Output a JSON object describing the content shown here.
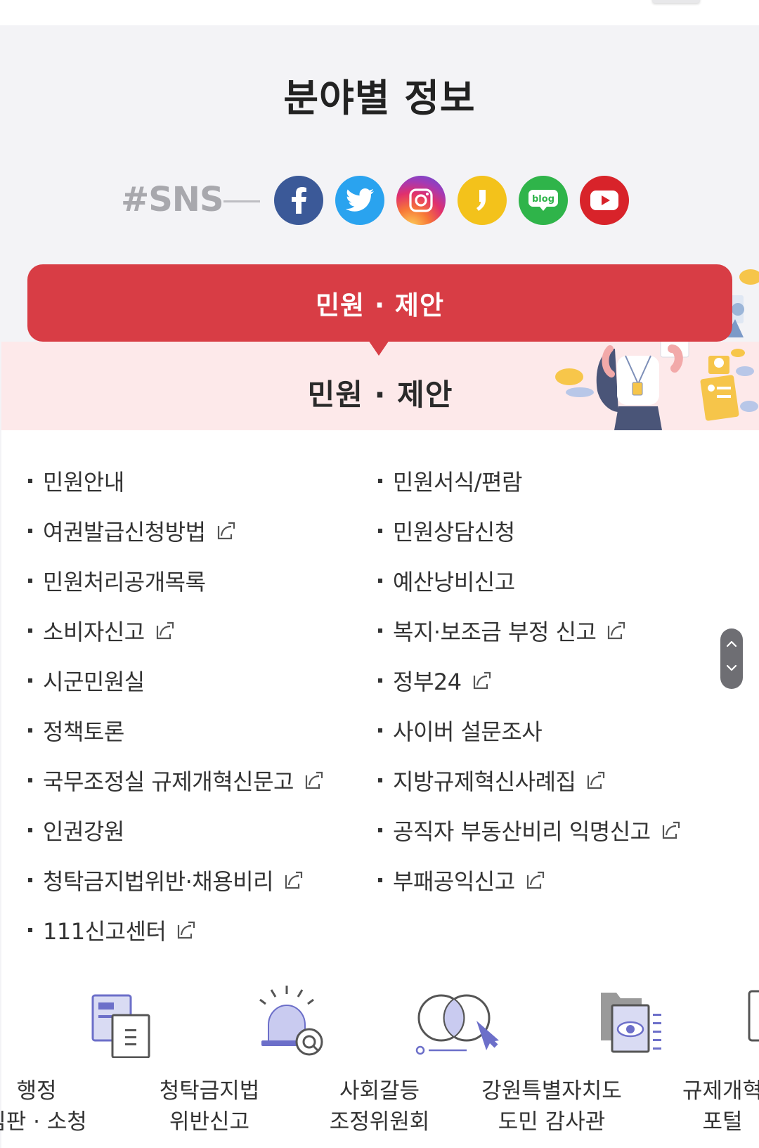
{
  "section_title": "분야별 정보",
  "sns": {
    "label": "#SNS",
    "links": [
      {
        "name": "facebook",
        "color": "#3b5998",
        "icon": "facebook-icon"
      },
      {
        "name": "twitter",
        "color": "#1da1f2",
        "icon": "twitter-icon"
      },
      {
        "name": "instagram",
        "color": "#e1306c",
        "icon": "instagram-icon"
      },
      {
        "name": "kakaostory",
        "color": "#f5c400",
        "icon": "kakaostory-icon"
      },
      {
        "name": "blog",
        "color": "#2db400",
        "icon": "blog-icon",
        "text": "blog"
      },
      {
        "name": "youtube",
        "color": "#e62117",
        "icon": "youtube-icon"
      }
    ]
  },
  "category_tab": "민원 · 제안",
  "banner_title": "민원 · 제안",
  "menu": {
    "left": [
      {
        "label": "민원안내",
        "external": false
      },
      {
        "label": "여권발급신청방법",
        "external": true
      },
      {
        "label": "민원처리공개목록",
        "external": false
      },
      {
        "label": "소비자신고",
        "external": true
      },
      {
        "label": "시군민원실",
        "external": false
      },
      {
        "label": "정책토론",
        "external": false
      },
      {
        "label": "국무조정실 규제개혁신문고",
        "external": true
      },
      {
        "label": "인권강원",
        "external": false
      },
      {
        "label": "청탁금지법위반·채용비리",
        "external": true
      },
      {
        "label": "111신고센터",
        "external": true
      }
    ],
    "right": [
      {
        "label": "민원서식/편람",
        "external": false
      },
      {
        "label": "민원상담신청",
        "external": false
      },
      {
        "label": "예산낭비신고",
        "external": false
      },
      {
        "label": "복지·보조금 부정 신고",
        "external": true
      },
      {
        "label": "정부24",
        "external": true
      },
      {
        "label": "사이버 설문조사",
        "external": false
      },
      {
        "label": "지방규제혁신사례집",
        "external": true
      },
      {
        "label": "공직자 부동산비리 익명신고",
        "external": true
      },
      {
        "label": "부패공익신고",
        "external": true
      }
    ]
  },
  "quick_links": [
    {
      "line1": "행정",
      "line2": "심판 · 소청",
      "icon": "document-icon"
    },
    {
      "line1": "청탁금지법",
      "line2": "위반신고",
      "icon": "siren-icon"
    },
    {
      "line1": "사회갈등",
      "line2": "조정위원회",
      "icon": "overlap-circles-icon"
    },
    {
      "line1": "강원특별자치도",
      "line2": "도민 감사관",
      "icon": "folder-eye-icon"
    },
    {
      "line1": "규제개혁",
      "line2": "포털",
      "icon": "monitor-shield-icon"
    }
  ],
  "colors": {
    "accent_red": "#d83d45",
    "banner_pink": "#fde9ea",
    "icon_purple": "#6c6fc9"
  }
}
